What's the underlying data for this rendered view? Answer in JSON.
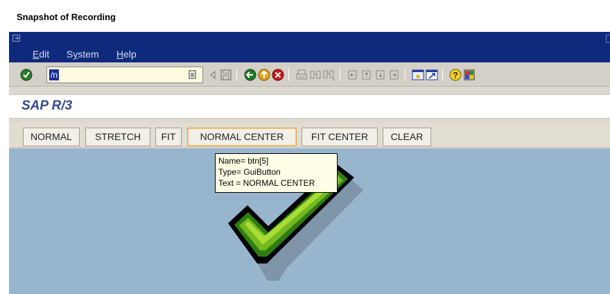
{
  "window": {
    "title": "Snapshot of Recording"
  },
  "menu": {
    "items": [
      {
        "label": "Edit",
        "accel": "E",
        "rest": "dit"
      },
      {
        "label": "System",
        "accel": "y",
        "pre": "S",
        "rest": "stem"
      },
      {
        "label": "Help",
        "accel": "H",
        "rest": "elp"
      }
    ]
  },
  "toolbar": {
    "command_value": "/n",
    "icons": [
      "enter-icon",
      "history-dropdown-icon",
      "back-arrow-icon",
      "save-icon",
      "back-icon",
      "exit-icon",
      "cancel-icon",
      "print-icon",
      "find-icon",
      "find-next-icon",
      "first-page-icon",
      "previous-page-icon",
      "next-page-icon",
      "last-page-icon",
      "create-session-icon",
      "shortcut-icon",
      "help-icon",
      "customize-layout-icon"
    ]
  },
  "app": {
    "title": "SAP R/3"
  },
  "appbar": {
    "buttons": [
      "NORMAL",
      "STRETCH",
      "FIT",
      "NORMAL CENTER",
      "FIT CENTER",
      "CLEAR"
    ],
    "focused_index": 3
  },
  "tooltip": {
    "name_line": "Name= btn[5]",
    "type_line": "Type= GuiButton",
    "text_line": "Text = NORMAL CENTER"
  },
  "colors": {
    "menubar": "#0f2a7c",
    "canvas": "#98b5ce",
    "check_green_dark": "#3e8c14",
    "check_green_light": "#9ed62a",
    "tooltip_bg": "#fffee7"
  }
}
